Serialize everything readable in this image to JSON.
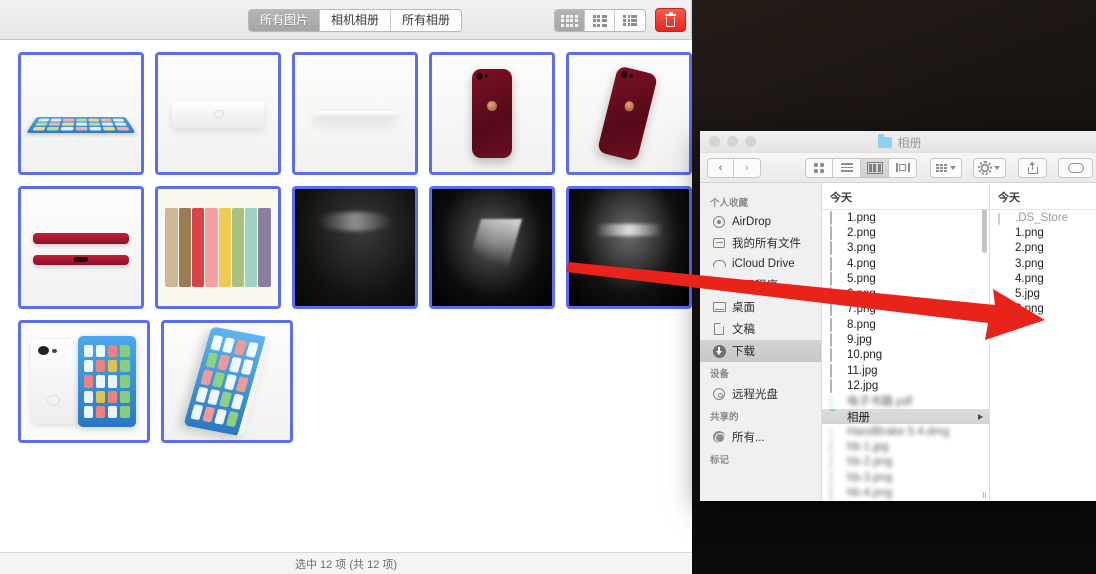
{
  "photo_app": {
    "tabs": [
      {
        "label": "所有图片",
        "active": true
      },
      {
        "label": "相机相册",
        "active": false
      },
      {
        "label": "所有相册",
        "active": false
      }
    ],
    "view_modes": [
      {
        "name": "grid-view",
        "active": true
      },
      {
        "name": "list-detail-view",
        "active": false
      },
      {
        "name": "list-compact-view",
        "active": false
      }
    ],
    "delete_button": "trash-icon",
    "status": "选中 12 项 (共 12 项)",
    "thumbnails": [
      {
        "name": "thumb-1",
        "art": "ipad-flat",
        "selected": true
      },
      {
        "name": "thumb-2",
        "art": "white-slab",
        "selected": true
      },
      {
        "name": "thumb-3",
        "art": "white-edge",
        "selected": true
      },
      {
        "name": "thumb-4",
        "art": "phone-red-back",
        "selected": true
      },
      {
        "name": "thumb-5",
        "art": "phone-red-tilt",
        "selected": true
      },
      {
        "name": "thumb-6",
        "art": "phone-red-sides",
        "selected": true
      },
      {
        "name": "thumb-7",
        "art": "color-covers",
        "selected": true
      },
      {
        "name": "thumb-8",
        "art": "dark-shot",
        "selected": true
      },
      {
        "name": "thumb-9",
        "art": "dark-beam",
        "selected": true
      },
      {
        "name": "thumb-10",
        "art": "dark-wide",
        "selected": true
      },
      {
        "name": "thumb-11",
        "art": "tablet-white-pair",
        "selected": true
      },
      {
        "name": "thumb-12",
        "art": "tablet-angled",
        "selected": true
      }
    ]
  },
  "finder": {
    "title": "相册",
    "toolbar": {
      "back": "‹",
      "forward": "›",
      "view_icon": "icon-view",
      "view_list": "list-view",
      "view_column": "column-view",
      "view_coverflow": "coverflow-view",
      "arrange": "arrange-menu",
      "action": "action-menu",
      "share": "share-button",
      "tags": "tags-button"
    },
    "sidebar": {
      "sections": [
        {
          "header": "个人收藏",
          "items": [
            {
              "label": "AirDrop",
              "icon": "airdrop-icon",
              "active": false
            },
            {
              "label": "我的所有文件",
              "icon": "all-files-icon",
              "active": false
            },
            {
              "label": "iCloud Drive",
              "icon": "icloud-icon",
              "active": false
            },
            {
              "label": "应用程序",
              "icon": "applications-icon",
              "active": false
            },
            {
              "label": "桌面",
              "icon": "desktop-icon",
              "active": false
            },
            {
              "label": "文稿",
              "icon": "documents-icon",
              "active": false
            },
            {
              "label": "下载",
              "icon": "downloads-icon",
              "active": true
            }
          ]
        },
        {
          "header": "设备",
          "items": [
            {
              "label": "远程光盘",
              "icon": "remote-disc-icon",
              "active": false
            }
          ]
        },
        {
          "header": "共享的",
          "items": [
            {
              "label": "所有...",
              "icon": "all-shared-icon",
              "active": false
            }
          ]
        },
        {
          "header": "标记",
          "items": []
        }
      ]
    },
    "middle_column": {
      "header": "今天",
      "files": [
        {
          "label": "1.png",
          "icon": "image-file-icon",
          "selected": false,
          "blurred": false
        },
        {
          "label": "2.png",
          "icon": "image-file-icon",
          "selected": false,
          "blurred": false
        },
        {
          "label": "3.png",
          "icon": "image-file-icon",
          "selected": false,
          "blurred": false
        },
        {
          "label": "4.png",
          "icon": "image-file-icon",
          "selected": false,
          "blurred": false
        },
        {
          "label": "5.png",
          "icon": "image-file-icon",
          "selected": false,
          "blurred": false
        },
        {
          "label": "6.png",
          "icon": "image-file-icon",
          "selected": false,
          "blurred": false
        },
        {
          "label": "7.png",
          "icon": "image-file-icon",
          "selected": false,
          "blurred": false
        },
        {
          "label": "8.png",
          "icon": "image-file-icon",
          "selected": false,
          "blurred": false
        },
        {
          "label": "9.jpg",
          "icon": "image-file-icon",
          "selected": false,
          "blurred": false
        },
        {
          "label": "10.png",
          "icon": "image-file-icon",
          "selected": false,
          "blurred": false
        },
        {
          "label": "11.jpg",
          "icon": "image-file-icon",
          "selected": false,
          "blurred": false
        },
        {
          "label": "12.jpg",
          "icon": "image-file-icon",
          "selected": false,
          "blurred": false
        },
        {
          "label": "",
          "icon": "pdf-file-icon",
          "selected": false,
          "blurred": true
        },
        {
          "label": "相册",
          "icon": "folder-icon",
          "selected": true,
          "blurred": false
        },
        {
          "label": "",
          "icon": "dmg-file-icon",
          "selected": false,
          "blurred": true
        },
        {
          "label": "",
          "icon": "image-file-icon",
          "selected": false,
          "blurred": true
        },
        {
          "label": "",
          "icon": "image-file-icon",
          "selected": false,
          "blurred": true
        },
        {
          "label": "",
          "icon": "image-file-icon",
          "selected": false,
          "blurred": true
        },
        {
          "label": "",
          "icon": "image-file-icon",
          "selected": false,
          "blurred": true
        },
        {
          "label": "",
          "icon": "image-file-icon",
          "selected": false,
          "blurred": true
        }
      ]
    },
    "right_column": {
      "header": "今天",
      "files": [
        {
          "label": ".DS_Store",
          "icon": "generic-file-icon",
          "tint": "none"
        },
        {
          "label": "1.png",
          "icon": "image-file-icon",
          "tint": "blue"
        },
        {
          "label": "2.png",
          "icon": "image-file-icon",
          "tint": "dark"
        },
        {
          "label": "3.png",
          "icon": "image-file-icon",
          "tint": "dark"
        },
        {
          "label": "4.png",
          "icon": "image-file-icon",
          "tint": "dark"
        },
        {
          "label": "5.jpg",
          "icon": "image-file-icon",
          "tint": "dark"
        },
        {
          "label": "6.png",
          "icon": "image-file-icon",
          "tint": "dark"
        }
      ]
    }
  },
  "annotation": {
    "arrow": "red-drag-arrow",
    "color": "#e8231a"
  }
}
